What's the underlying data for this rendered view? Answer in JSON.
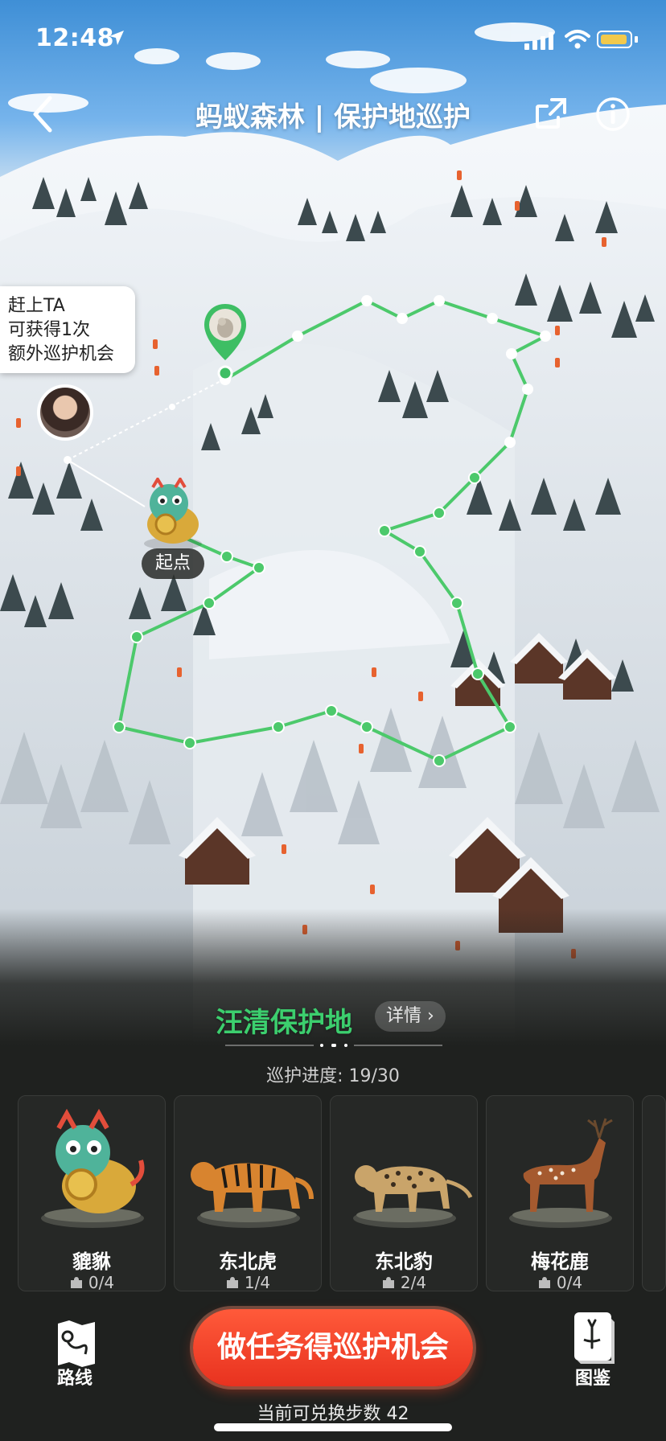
{
  "status_bar": {
    "time": "12:48",
    "battery_color": "#f2c94c"
  },
  "nav": {
    "title": "蚂蚁森林 | 保护地巡护",
    "back_icon": "chevron-left-icon",
    "share_icon": "share-icon",
    "info_icon": "info-icon"
  },
  "map": {
    "chase_callout": {
      "line1": "赶上TA",
      "line2": "可获得1次",
      "line3": "额外巡护机会"
    },
    "start_label": "起点",
    "route_color": "#4cc96b",
    "progress_fraction": 0.633
  },
  "reserve": {
    "name": "汪清保护地",
    "detail_label": "详情 ›",
    "progress_text": "巡护进度: 19/30"
  },
  "animals": [
    {
      "name": "貔貅",
      "count": "0/4"
    },
    {
      "name": "东北虎",
      "count": "1/4"
    },
    {
      "name": "东北豹",
      "count": "2/4"
    },
    {
      "name": "梅花鹿",
      "count": "0/4"
    }
  ],
  "actions": {
    "route_label": "路线",
    "task_button": "做任务得巡护机会",
    "guide_label": "图鉴",
    "steps_text": "当前可兑换步数 42"
  }
}
